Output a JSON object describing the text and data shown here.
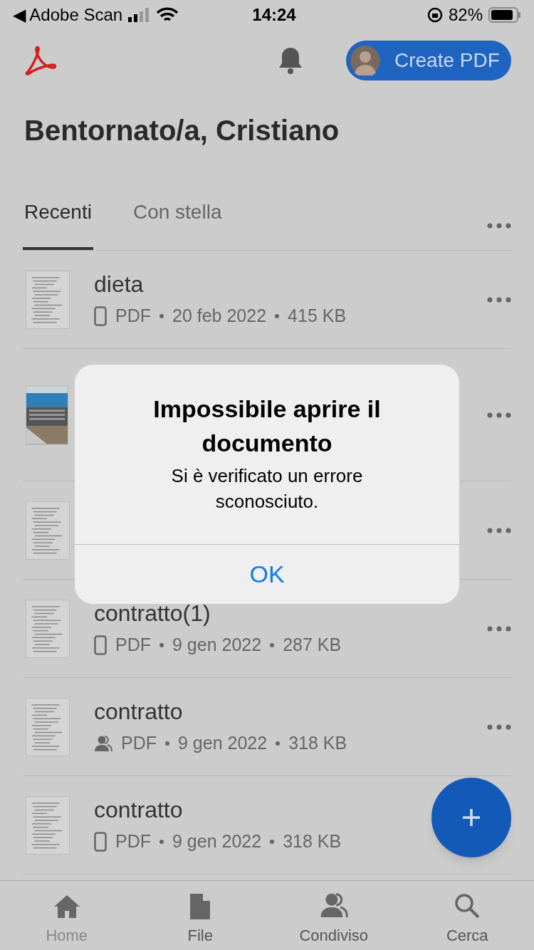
{
  "status_bar": {
    "back_app": "◀ Adobe Scan",
    "time": "14:24",
    "battery": "82%"
  },
  "header": {
    "create_button": "Create PDF"
  },
  "title": "Bentornato/a, Cristiano",
  "tabs": [
    {
      "label": "Recenti",
      "selected": true
    },
    {
      "label": "Con stella",
      "selected": false
    }
  ],
  "files": [
    {
      "kind": "document",
      "name": "dieta",
      "shared": false,
      "type": "PDF",
      "date": "20 feb 2022",
      "size": "415 KB"
    },
    {
      "kind": "picture"
    },
    {
      "kind": "document"
    },
    {
      "kind": "document",
      "name": "contratto(1)",
      "shared": false,
      "type": "PDF",
      "date": "9 gen 2022",
      "size": "287 KB"
    },
    {
      "kind": "document",
      "name": "contratto",
      "shared": true,
      "type": "PDF",
      "date": "9 gen 2022",
      "size": "318 KB"
    },
    {
      "kind": "document",
      "name": "contratto",
      "shared": false,
      "type": "PDF",
      "date": "9 gen 2022",
      "size": "318 KB"
    }
  ],
  "bottom_nav": [
    {
      "label": "Home",
      "kind": "home"
    },
    {
      "label": "File",
      "kind": "file"
    },
    {
      "label": "Condiviso",
      "kind": "shared"
    },
    {
      "label": "Cerca",
      "kind": "search"
    }
  ],
  "alert": {
    "title": "Impossibile aprire il documento",
    "message": "Si è verificato un errore sconosciuto.",
    "button": "OK"
  }
}
